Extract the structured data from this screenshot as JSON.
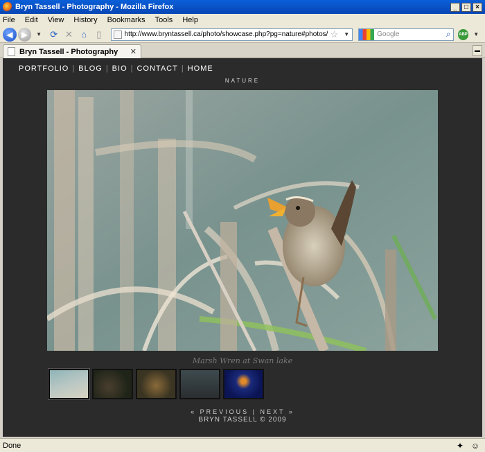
{
  "window": {
    "title": "Bryn Tassell - Photography - Mozilla Firefox",
    "minimize_glyph": "_",
    "maximize_glyph": "□",
    "close_glyph": "×"
  },
  "menu": [
    "File",
    "Edit",
    "View",
    "History",
    "Bookmarks",
    "Tools",
    "Help"
  ],
  "navbar": {
    "url": "http://www.bryntassell.ca/photo/showcase.php?pg=nature#photos/MarshW",
    "search_placeholder": "Google"
  },
  "tab": {
    "label": "Bryn Tassell - Photography"
  },
  "site": {
    "nav": [
      "PORTFOLIO",
      "BLOG",
      "BIO",
      "CONTACT",
      "HOME"
    ],
    "section": "NATURE",
    "caption": "Marsh Wren at Swan lake",
    "pager": "« PREVIOUS | NEXT »",
    "copyright": "BRYN TASSELL © 2009"
  },
  "status": {
    "text": "Done"
  },
  "icons": {
    "back": "back-arrow-icon",
    "forward": "forward-arrow-icon",
    "reload": "reload-icon",
    "stop": "stop-icon",
    "home": "home-icon",
    "bookmark": "star-icon"
  }
}
